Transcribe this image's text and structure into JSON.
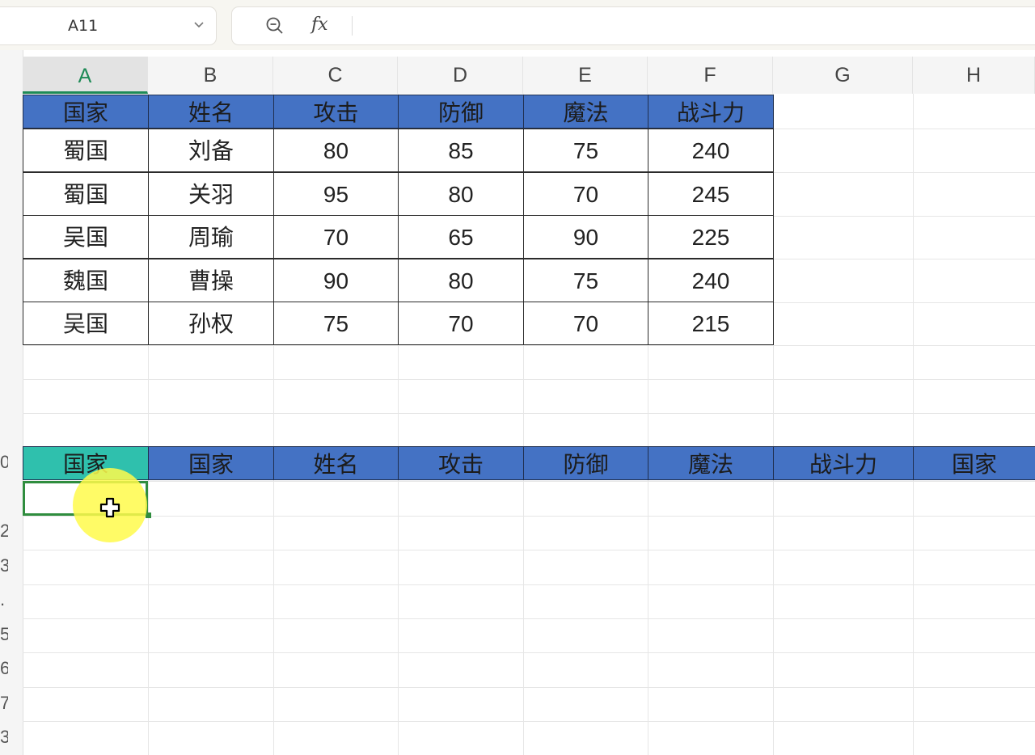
{
  "name_box": {
    "value": "A11"
  },
  "formula_bar": {
    "fx_label": "fx",
    "value": ""
  },
  "columns": [
    {
      "letter": "A",
      "selected": true
    },
    {
      "letter": "B",
      "selected": false
    },
    {
      "letter": "C",
      "selected": false
    },
    {
      "letter": "D",
      "selected": false
    },
    {
      "letter": "E",
      "selected": false
    },
    {
      "letter": "F",
      "selected": false
    },
    {
      "letter": "G",
      "selected": false
    },
    {
      "letter": "H",
      "selected": false
    }
  ],
  "row_numbers": [
    "0",
    "",
    "2",
    "3",
    ".",
    "5",
    "6",
    "7",
    "3"
  ],
  "table": {
    "headers": [
      "国家",
      "姓名",
      "攻击",
      "防御",
      "魔法",
      "战斗力"
    ],
    "rows": [
      [
        "蜀国",
        "刘备",
        "80",
        "85",
        "75",
        "240"
      ],
      [
        "蜀国",
        "关羽",
        "95",
        "80",
        "70",
        "245"
      ],
      [
        "吴国",
        "周瑜",
        "70",
        "65",
        "90",
        "225"
      ],
      [
        "魏国",
        "曹操",
        "90",
        "80",
        "75",
        "240"
      ],
      [
        "吴国",
        "孙权",
        "75",
        "70",
        "70",
        "215"
      ]
    ]
  },
  "second_header_row": [
    "国家",
    "国家",
    "姓名",
    "攻击",
    "防御",
    "魔法",
    "战斗力",
    "国家"
  ],
  "colors": {
    "header_blue": "#4472c4",
    "header_teal": "#2fc0ad",
    "selection_green": "#2f8d3e",
    "cursor_highlight": "#fffa4b"
  }
}
